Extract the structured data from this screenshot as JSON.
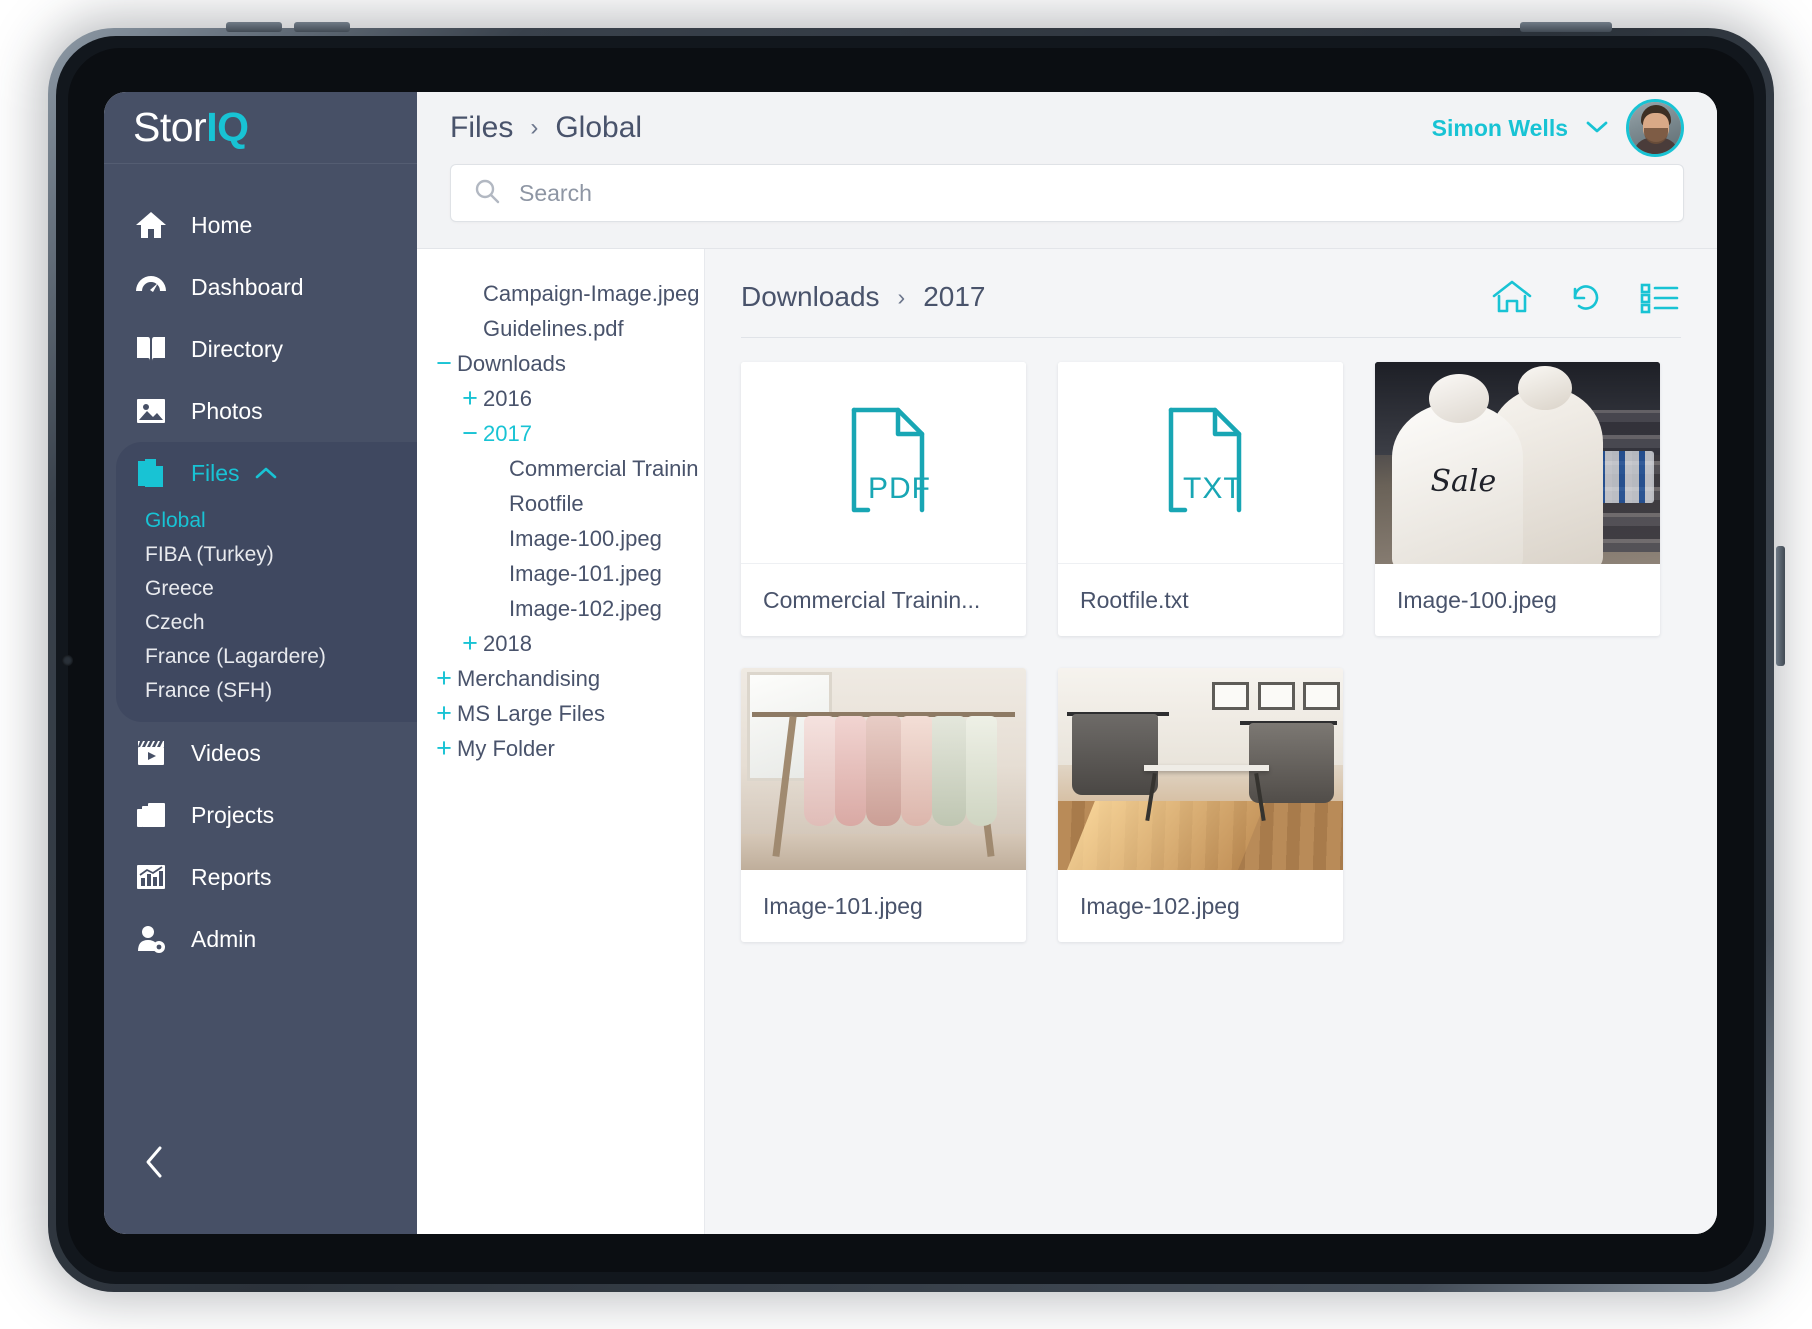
{
  "brand": {
    "part1": "Stor",
    "part2": "IQ"
  },
  "sidebar": {
    "items": [
      {
        "label": "Home",
        "icon": "home-icon"
      },
      {
        "label": "Dashboard",
        "icon": "dashboard-icon"
      },
      {
        "label": "Directory",
        "icon": "book-icon"
      },
      {
        "label": "Photos",
        "icon": "photo-icon"
      }
    ],
    "files_group": {
      "label": "Files",
      "icon": "files-icon",
      "chevron": "chevron-up-icon",
      "sub_items": [
        {
          "label": "Global",
          "active": true
        },
        {
          "label": "FIBA (Turkey)",
          "active": false
        },
        {
          "label": "Greece",
          "active": false
        },
        {
          "label": "Czech",
          "active": false
        },
        {
          "label": "France (Lagardere)",
          "active": false
        },
        {
          "label": "France (SFH)",
          "active": false
        }
      ]
    },
    "items_bottom": [
      {
        "label": "Videos",
        "icon": "video-icon"
      },
      {
        "label": "Projects",
        "icon": "projects-icon"
      },
      {
        "label": "Reports",
        "icon": "reports-icon"
      },
      {
        "label": "Admin",
        "icon": "admin-icon"
      }
    ],
    "collapse_icon": "chevron-left-icon"
  },
  "topbar": {
    "breadcrumb": [
      "Files",
      "Global"
    ],
    "separator": "›",
    "user_name": "Simon Wells",
    "user_chevron": "chevron-down-icon",
    "avatar": "user-avatar"
  },
  "search": {
    "value": "",
    "placeholder": "Search",
    "icon": "search-icon"
  },
  "tree": {
    "rows": [
      {
        "label": "Campaign-Image.jpeg",
        "toggle": "",
        "depth": 1,
        "teal": false
      },
      {
        "label": "Guidelines.pdf",
        "toggle": "",
        "depth": 1,
        "teal": false
      },
      {
        "label": "Downloads",
        "toggle": "−",
        "depth": 0,
        "teal": false
      },
      {
        "label": "2016",
        "toggle": "+",
        "depth": 1,
        "teal": false
      },
      {
        "label": "2017",
        "toggle": "−",
        "depth": 1,
        "teal": true
      },
      {
        "label": "Commercial Trainin",
        "toggle": "",
        "depth": 2,
        "teal": false
      },
      {
        "label": "Rootfile",
        "toggle": "",
        "depth": 2,
        "teal": false
      },
      {
        "label": "Image-100.jpeg",
        "toggle": "",
        "depth": 2,
        "teal": false
      },
      {
        "label": "Image-101.jpeg",
        "toggle": "",
        "depth": 2,
        "teal": false
      },
      {
        "label": "Image-102.jpeg",
        "toggle": "",
        "depth": 2,
        "teal": false
      },
      {
        "label": "2018",
        "toggle": "+",
        "depth": 1,
        "teal": false
      },
      {
        "label": "Merchandising",
        "toggle": "+",
        "depth": 0,
        "teal": false
      },
      {
        "label": "MS Large Files",
        "toggle": "+",
        "depth": 0,
        "teal": false
      },
      {
        "label": "My Folder",
        "toggle": "+",
        "depth": 0,
        "teal": false
      }
    ]
  },
  "content": {
    "breadcrumb": [
      "Downloads",
      "2017"
    ],
    "separator": "›",
    "tools": [
      {
        "name": "home-icon"
      },
      {
        "name": "refresh-icon"
      },
      {
        "name": "list-view-icon"
      }
    ],
    "cards": [
      {
        "label": "Commercial Trainin...",
        "thumb": "pdf",
        "badge": "PDF"
      },
      {
        "label": "Rootfile.txt",
        "thumb": "txt",
        "badge": "TXT"
      },
      {
        "label": "Image-100.jpeg",
        "thumb": "photo",
        "badge": ""
      },
      {
        "label": "Image-101.jpeg",
        "thumb": "photo",
        "badge": ""
      },
      {
        "label": "Image-102.jpeg",
        "thumb": "photo",
        "badge": ""
      }
    ]
  },
  "colors": {
    "accent": "#18c3d4",
    "sidebar": "#475066",
    "sidebar_active": "#3f4860",
    "text_dark": "#49536b",
    "page_bg": "#f4f5f7"
  }
}
